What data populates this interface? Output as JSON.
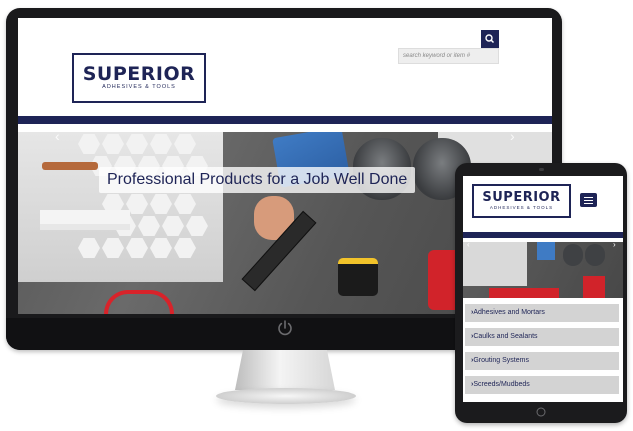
{
  "brand": {
    "name": "SUPERIOR",
    "tagline": "ADHESIVES & TOOLS",
    "color": "#1e2456"
  },
  "desktop": {
    "search": {
      "placeholder": "search keyword or item #",
      "icon": "search-icon"
    },
    "hero": {
      "caption": "Professional Products for a Job Well Done",
      "prev_icon": "chevron-left-icon",
      "next_icon": "chevron-right-icon"
    },
    "power_icon": "power-icon"
  },
  "tablet": {
    "menu_icon": "hamburger-menu-icon",
    "menu_items": [
      {
        "label": "Adhesives and Mortars"
      },
      {
        "label": "Caulks and Sealants"
      },
      {
        "label": "Grouting Systems"
      },
      {
        "label": "Screeds/Mudbeds"
      }
    ]
  }
}
